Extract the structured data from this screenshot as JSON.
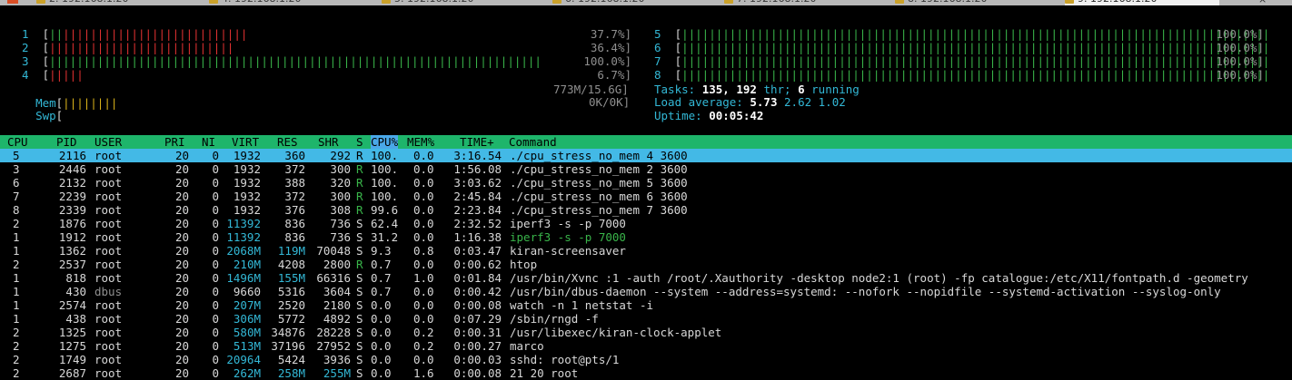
{
  "tabs": [
    {
      "label": "2. 192.168.1.20",
      "active": false
    },
    {
      "label": "4. 192.168.1.20",
      "active": false
    },
    {
      "label": "5. 192.168.1.20",
      "active": false
    },
    {
      "label": "6. 192.168.1.20",
      "active": false
    },
    {
      "label": "7. 192.168.1.20",
      "active": false
    },
    {
      "label": "8. 192.168.1.20",
      "active": false
    },
    {
      "label": "9. 192.168.1.20",
      "active": true
    }
  ],
  "tab_close": "×",
  "cpu_meters_left": [
    {
      "id": "1",
      "bar_text": "|||||||||||||||||||||||||||||",
      "bar_split": 2,
      "percent": "37.7%]",
      "usage": 37.7
    },
    {
      "id": "2",
      "bar_text": "|||||||||||||||||||||||||||",
      "bar_split": 0,
      "percent": "36.4%]",
      "usage": 36.4
    },
    {
      "id": "3",
      "bar_text": "||||||||||||||||||||||||||||||||||||||||||||||||||||||||||||||||||||||||",
      "bar_split": 72,
      "percent": "100.0%]",
      "usage": 100.0
    },
    {
      "id": "4",
      "bar_text": "|||||",
      "bar_split": 0,
      "percent": "6.7%]",
      "usage": 6.7
    }
  ],
  "cpu_meters_right": [
    {
      "id": "5",
      "bar_text": "||||||||||||||||||||||||||||||||||||||||||||||||||||||||||||||||||||||||||||||||||||||",
      "percent": "100.0%]",
      "usage": 100.0
    },
    {
      "id": "6",
      "bar_text": "||||||||||||||||||||||||||||||||||||||||||||||||||||||||||||||||||||||||||||||||||||||",
      "percent": "100.0%]",
      "usage": 100.0
    },
    {
      "id": "7",
      "bar_text": "||||||||||||||||||||||||||||||||||||||||||||||||||||||||||||||||||||||||||||||||||||||",
      "percent": "100.0%]",
      "usage": 100.0
    },
    {
      "id": "8",
      "bar_text": "||||||||||||||||||||||||||||||||||||||||||||||||||||||||||||||||||||||||||||||||||||||",
      "percent": "100.0%]",
      "usage": 100.0
    }
  ],
  "mem": {
    "label": "Mem",
    "bar_text": "||||||||",
    "value": "773M/15.6G]"
  },
  "swp": {
    "label": "Swp",
    "bar_text": "",
    "value": "0K/0K]"
  },
  "tasks": {
    "label": "Tasks:",
    "tasks": "135,",
    "thr": "192",
    "thr_label": "thr;",
    "running": "6",
    "running_label": "running"
  },
  "load": {
    "label": "Load average:",
    "v1": "5.73",
    "v5": "2.62",
    "v15": "1.02"
  },
  "uptime": {
    "label": "Uptime:",
    "value": "00:05:42"
  },
  "columns": {
    "cpu": "CPU",
    "pid": "PID",
    "user": "USER",
    "pri": "PRI",
    "ni": "NI",
    "virt": "VIRT",
    "res": "RES",
    "shr": "SHR",
    "s": "S",
    "cpup": "CPU%",
    "memp": "MEM%",
    "time": "TIME+",
    "command": "Command"
  },
  "processes": [
    {
      "cpu": "5",
      "pid": "2116",
      "user": "root",
      "pri": "20",
      "ni": "0",
      "virt": "1932",
      "res": "360",
      "shr": "292",
      "s": "R",
      "cpup": "100.",
      "memp": "0.0",
      "time": "3:16.54",
      "cmd": "./cpu_stress_no_mem 4 3600",
      "selected": true
    },
    {
      "cpu": "3",
      "pid": "2446",
      "user": "root",
      "pri": "20",
      "ni": "0",
      "virt": "1932",
      "res": "372",
      "shr": "300",
      "s": "R",
      "cpup": "100.",
      "memp": "0.0",
      "time": "1:56.08",
      "cmd": "./cpu_stress_no_mem 2 3600"
    },
    {
      "cpu": "6",
      "pid": "2132",
      "user": "root",
      "pri": "20",
      "ni": "0",
      "virt": "1932",
      "res": "388",
      "shr": "320",
      "s": "R",
      "cpup": "100.",
      "memp": "0.0",
      "time": "3:03.62",
      "cmd": "./cpu_stress_no_mem 5 3600"
    },
    {
      "cpu": "7",
      "pid": "2239",
      "user": "root",
      "pri": "20",
      "ni": "0",
      "virt": "1932",
      "res": "372",
      "shr": "300",
      "s": "R",
      "cpup": "100.",
      "memp": "0.0",
      "time": "2:45.84",
      "cmd": "./cpu_stress_no_mem 6 3600"
    },
    {
      "cpu": "8",
      "pid": "2339",
      "user": "root",
      "pri": "20",
      "ni": "0",
      "virt": "1932",
      "res": "376",
      "shr": "308",
      "s": "R",
      "cpup": "99.6",
      "memp": "0.0",
      "time": "2:23.84",
      "cmd": "./cpu_stress_no_mem 7 3600"
    },
    {
      "cpu": "2",
      "pid": "1876",
      "user": "root",
      "pri": "20",
      "ni": "0",
      "virt": "11392",
      "res": "836",
      "shr": "736",
      "s": "S",
      "cpup": "62.4",
      "memp": "0.0",
      "time": "2:32.52",
      "cmd": "iperf3 -s -p 7000"
    },
    {
      "cpu": "1",
      "pid": "1912",
      "user": "root",
      "pri": "20",
      "ni": "0",
      "virt": "11392",
      "res": "836",
      "shr": "736",
      "s": "S",
      "cpup": "31.2",
      "memp": "0.0",
      "time": "1:16.38",
      "cmd": "iperf3 -s -p 7000",
      "green": true
    },
    {
      "cpu": "1",
      "pid": "1362",
      "user": "root",
      "pri": "20",
      "ni": "0",
      "virt": "2068M",
      "res": "119M",
      "shr": "70048",
      "s": "S",
      "cpup": "9.3",
      "memp": "0.8",
      "time": "0:03.47",
      "cmd": "kiran-screensaver"
    },
    {
      "cpu": "2",
      "pid": "2537",
      "user": "root",
      "pri": "20",
      "ni": "0",
      "virt": "210M",
      "res": "4208",
      "shr": "2800",
      "s": "R",
      "cpup": "0.7",
      "memp": "0.0",
      "time": "0:00.62",
      "cmd": "htop"
    },
    {
      "cpu": "1",
      "pid": "818",
      "user": "root",
      "pri": "20",
      "ni": "0",
      "virt": "1496M",
      "res": "155M",
      "shr": "66316",
      "s": "S",
      "cpup": "0.7",
      "memp": "1.0",
      "time": "0:01.84",
      "cmd": "/usr/bin/Xvnc :1 -auth /root/.Xauthority -desktop node2:1 (root) -fp catalogue:/etc/X11/fontpath.d -geometry"
    },
    {
      "cpu": "1",
      "pid": "430",
      "user": "dbus",
      "pri": "20",
      "ni": "0",
      "virt": "9660",
      "res": "5316",
      "shr": "3604",
      "s": "S",
      "cpup": "0.7",
      "memp": "0.0",
      "time": "0:00.42",
      "cmd": "/usr/bin/dbus-daemon --system --address=systemd: --nofork --nopidfile --systemd-activation --syslog-only",
      "user_dim": true
    },
    {
      "cpu": "1",
      "pid": "2574",
      "user": "root",
      "pri": "20",
      "ni": "0",
      "virt": "207M",
      "res": "2520",
      "shr": "2180",
      "s": "S",
      "cpup": "0.0",
      "memp": "0.0",
      "time": "0:00.08",
      "cmd": "watch -n 1 netstat -i"
    },
    {
      "cpu": "1",
      "pid": "438",
      "user": "root",
      "pri": "20",
      "ni": "0",
      "virt": "306M",
      "res": "5772",
      "shr": "4892",
      "s": "S",
      "cpup": "0.0",
      "memp": "0.0",
      "time": "0:07.29",
      "cmd": "/sbin/rngd -f"
    },
    {
      "cpu": "2",
      "pid": "1325",
      "user": "root",
      "pri": "20",
      "ni": "0",
      "virt": "580M",
      "res": "34876",
      "shr": "28228",
      "s": "S",
      "cpup": "0.0",
      "memp": "0.2",
      "time": "0:00.31",
      "cmd": "/usr/libexec/kiran-clock-applet"
    },
    {
      "cpu": "2",
      "pid": "1275",
      "user": "root",
      "pri": "20",
      "ni": "0",
      "virt": "513M",
      "res": "37196",
      "shr": "27952",
      "s": "S",
      "cpup": "0.0",
      "memp": "0.2",
      "time": "0:00.27",
      "cmd": "marco"
    },
    {
      "cpu": "2",
      "pid": "1749",
      "user": "root",
      "pri": "20",
      "ni": "0",
      "virt": "20964",
      "res": "5424",
      "shr": "3936",
      "s": "S",
      "cpup": "0.0",
      "memp": "0.0",
      "time": "0:00.03",
      "cmd": "sshd: root@pts/1"
    },
    {
      "cpu": "2",
      "pid": "2687",
      "user": "root",
      "pri": "20",
      "ni": "0",
      "virt": "262M",
      "res": "258M",
      "shr": "255M",
      "s": "S",
      "cpup": "0.0",
      "memp": "1.6",
      "time": "0:00.08",
      "cmd": "21 20 root"
    }
  ],
  "colors": {
    "header_bg": "#1eb56b",
    "selected_bg": "#43b9e6",
    "sort_col_bg": "#4aa8e8",
    "label": "#33b8d6",
    "bar_green": "#39b54a",
    "bar_red": "#e03131",
    "bar_yellow": "#d9b21a"
  }
}
